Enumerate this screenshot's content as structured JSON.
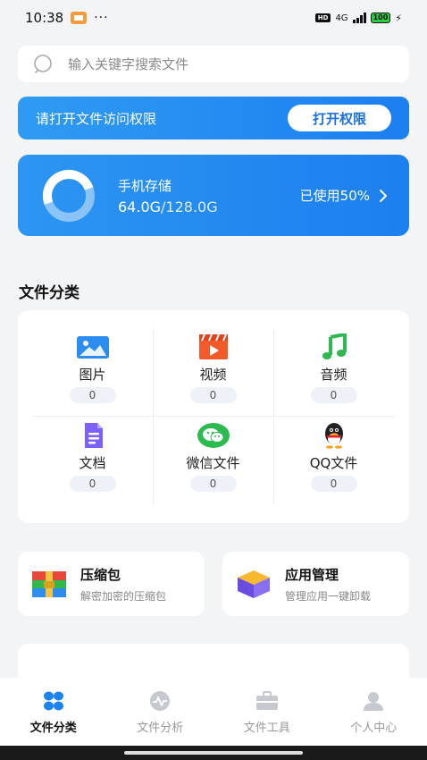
{
  "status_bar": {
    "time": "10:38",
    "more": "···",
    "hd": "HD",
    "network": "4G",
    "battery": "100"
  },
  "search": {
    "placeholder": "输入关键字搜索文件"
  },
  "permission_banner": {
    "text": "请打开文件访问权限",
    "button_label": "打开权限"
  },
  "storage": {
    "title": "手机存储",
    "used_amount": "64.0G",
    "total_amount": "/128.0G",
    "used_label": "已使用50%",
    "used_fraction": 0.5
  },
  "categories_section": {
    "title": "文件分类",
    "items": [
      {
        "label": "图片",
        "count": "0",
        "icon": "image-icon"
      },
      {
        "label": "视频",
        "count": "0",
        "icon": "video-icon"
      },
      {
        "label": "音频",
        "count": "0",
        "icon": "music-icon"
      },
      {
        "label": "文档",
        "count": "0",
        "icon": "document-icon"
      },
      {
        "label": "微信文件",
        "count": "0",
        "icon": "wechat-icon"
      },
      {
        "label": "QQ文件",
        "count": "0",
        "icon": "qq-icon"
      }
    ]
  },
  "tools": [
    {
      "title": "压缩包",
      "subtitle": "解密加密的压缩包",
      "icon": "archive-icon"
    },
    {
      "title": "应用管理",
      "subtitle": "管理应用一键卸载",
      "icon": "app-box-icon"
    }
  ],
  "tab_bar": {
    "tabs": [
      {
        "label": "文件分类",
        "icon": "category-grid-icon",
        "active": true
      },
      {
        "label": "文件分析",
        "icon": "analysis-icon",
        "active": false
      },
      {
        "label": "文件工具",
        "icon": "toolbox-icon",
        "active": false
      },
      {
        "label": "个人中心",
        "icon": "user-icon",
        "active": false
      }
    ]
  },
  "colors": {
    "accent_blue": "#1c7fef",
    "active_tab": "#1b84f0",
    "inactive_tab": "#c6c9cf"
  }
}
